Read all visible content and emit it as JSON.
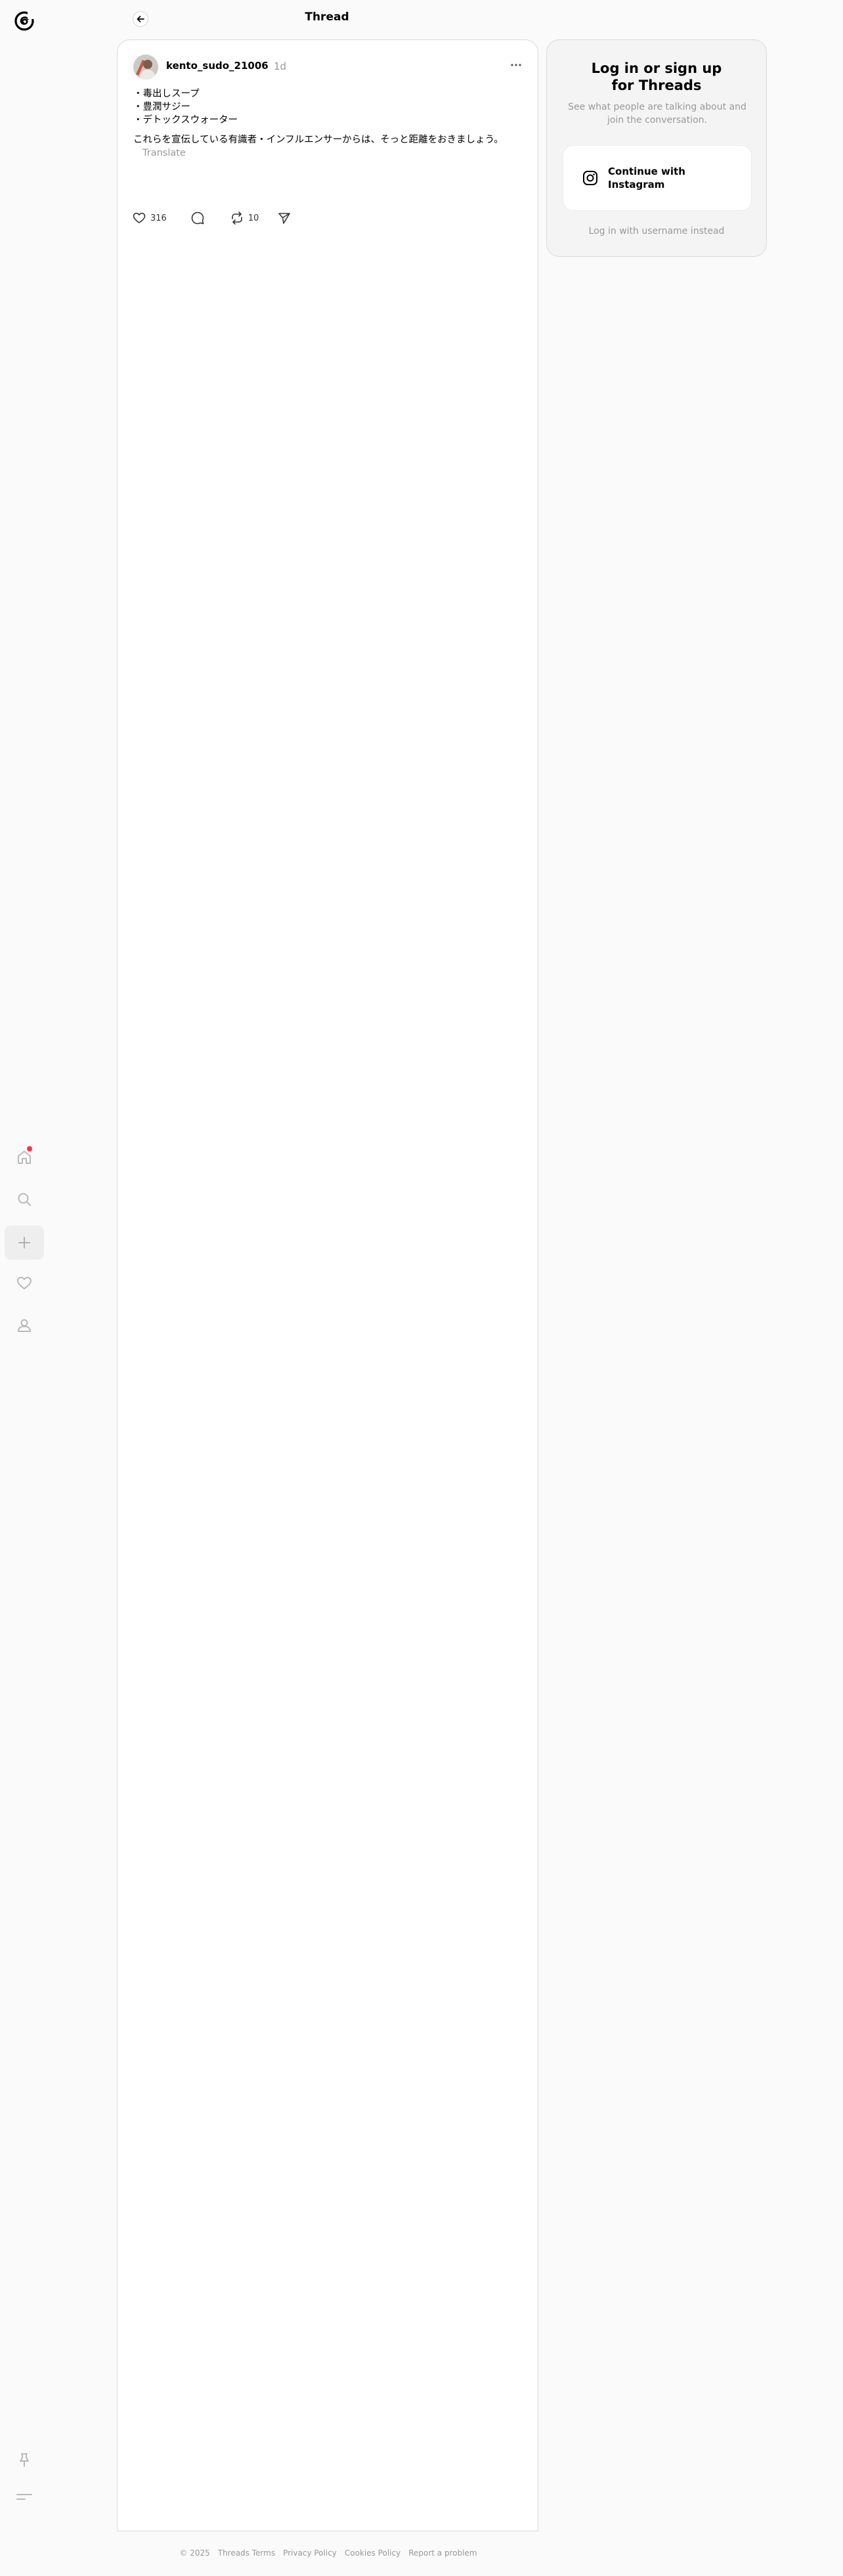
{
  "header": {
    "title": "Thread"
  },
  "post": {
    "username": "kento_sudo_21006",
    "time": "1d",
    "lines": [
      "・毒出しスープ",
      "・豊潤サジー",
      "・デトックスウォーター"
    ],
    "paragraph": "これらを宣伝している有識者・インフルエンサーからは、そっと距離をおきましょう。",
    "translate": "Translate",
    "likes": "316",
    "reposts": "10"
  },
  "login": {
    "title_line1": "Log in or sign up",
    "title_line2": "for Threads",
    "subtitle": "See what people are talking about and join the conversation.",
    "instagram_button": "Continue with Instagram",
    "alt_login": "Log in with username instead"
  },
  "footer": {
    "copyright": "© 2025",
    "links": [
      "Threads Terms",
      "Privacy Policy",
      "Cookies Policy",
      "Report a problem"
    ]
  },
  "icons": {
    "logo": "threads-logo",
    "nav": [
      "home-icon",
      "search-icon",
      "create-icon",
      "activity-heart-icon",
      "profile-icon"
    ],
    "bottom": [
      "pin-icon",
      "menu-icon"
    ]
  },
  "colors": {
    "notification": "#ff3040",
    "muted": "#999999"
  }
}
